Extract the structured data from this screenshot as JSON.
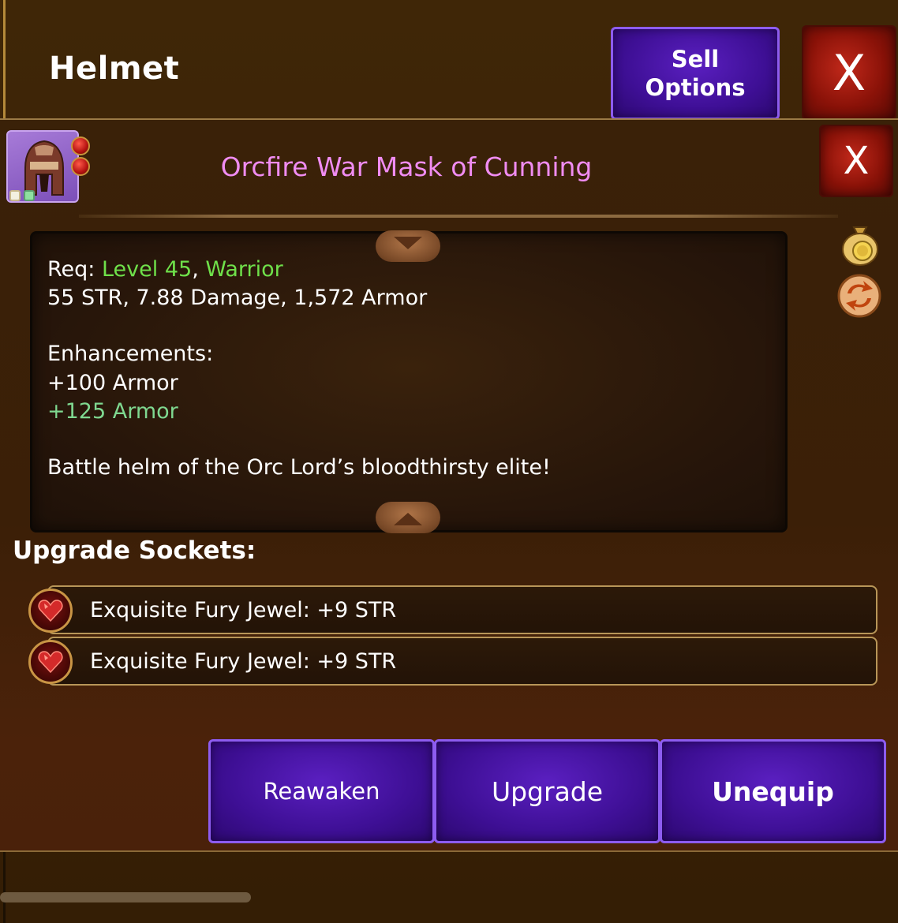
{
  "header": {
    "title": "Helmet",
    "sell_label_line1": "Sell",
    "sell_label_line2": "Options",
    "close_label": "X"
  },
  "item": {
    "name": "Orcfire War Mask of Cunning",
    "close_label": "X",
    "req_prefix": "Req: ",
    "req_level": "Level 45",
    "req_sep": ", ",
    "req_class": "Warrior",
    "stats": "55 STR, 7.88 Damage, 1,572 Armor",
    "enh_title": "Enhancements:",
    "enh_1": "+100 Armor",
    "enh_2": "+125 Armor",
    "flavor": "Battle helm of the Orc Lord’s bloodthirsty elite!"
  },
  "sockets": {
    "title": "Upgrade Sockets:",
    "items": [
      {
        "label": "Exquisite Fury Jewel: +9 STR"
      },
      {
        "label": "Exquisite Fury Jewel: +9 STR"
      }
    ]
  },
  "actions": {
    "reawaken": "Reawaken",
    "upgrade": "Upgrade",
    "unequip": "Unequip"
  },
  "colors": {
    "item_name": "#f08cf2",
    "req_green": "#6fe04a",
    "enh_green": "#7fd890",
    "button_purple": "#3e0f95",
    "close_red": "#8a1208"
  },
  "icons": {
    "item": "orc-war-mask-icon",
    "gem": "red-heart-gem-icon",
    "gold": "gold-coin-bag-icon",
    "swap": "swap-arrows-icon"
  }
}
